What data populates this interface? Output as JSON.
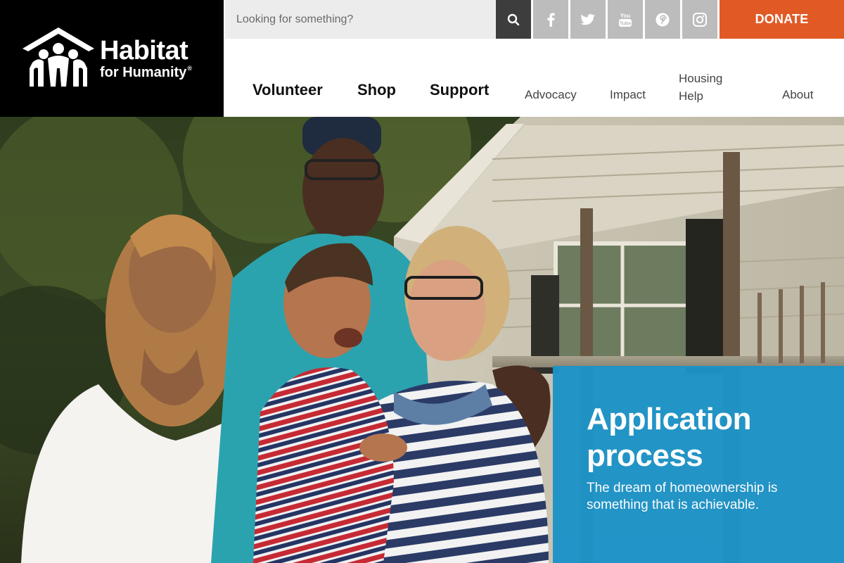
{
  "brand": {
    "name_line1": "Habitat",
    "name_line2": "for Humanity",
    "registered": "®",
    "background_color": "#000000"
  },
  "topbar": {
    "search_placeholder": "Looking for something?",
    "search_icon": "search-icon",
    "social_icons": [
      "facebook-icon",
      "twitter-icon",
      "youtube-icon",
      "pinterest-icon",
      "instagram-icon"
    ],
    "youtube_text": "You Tube",
    "donate_label": "DONATE",
    "donate_color": "#e15a26"
  },
  "nav": {
    "primary": [
      "Volunteer",
      "Shop",
      "Support"
    ],
    "secondary": [
      "Advocacy",
      "Impact",
      "Housing",
      "Help",
      "About"
    ]
  },
  "hero": {
    "callout_title_line1": "Application",
    "callout_title_line2": "process",
    "callout_desc_line1": "The dream of homeownership is",
    "callout_desc_line2": "something that is achievable.",
    "callout_color": "#1d93c7"
  }
}
